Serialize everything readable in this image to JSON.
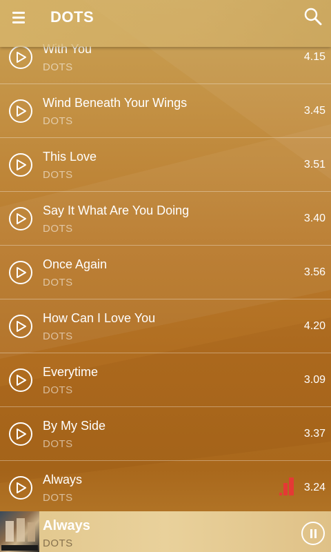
{
  "header": {
    "title": "DOTS",
    "menu_icon": "hamburger-menu-icon",
    "search_icon": "search-icon"
  },
  "songs": [
    {
      "title": "With You",
      "artist": "DOTS",
      "duration": "4.15"
    },
    {
      "title": "Wind Beneath Your Wings",
      "artist": "DOTS",
      "duration": "3.45"
    },
    {
      "title": "This Love",
      "artist": "DOTS",
      "duration": "3.51"
    },
    {
      "title": "Say It What Are You Doing",
      "artist": "DOTS",
      "duration": "3.40"
    },
    {
      "title": "Once Again",
      "artist": "DOTS",
      "duration": "3.56"
    },
    {
      "title": "How Can I Love You",
      "artist": "DOTS",
      "duration": "4.20"
    },
    {
      "title": "Everytime",
      "artist": "DOTS",
      "duration": "3.09"
    },
    {
      "title": "By My Side",
      "artist": "DOTS",
      "duration": "3.37"
    },
    {
      "title": "Always",
      "artist": "DOTS",
      "duration": "3.24",
      "playing": true
    }
  ],
  "now_playing": {
    "title": "Always",
    "artist": "DOTS",
    "state": "playing"
  },
  "colors": {
    "accent_eq": "#e53935",
    "text": "#ffffff"
  }
}
